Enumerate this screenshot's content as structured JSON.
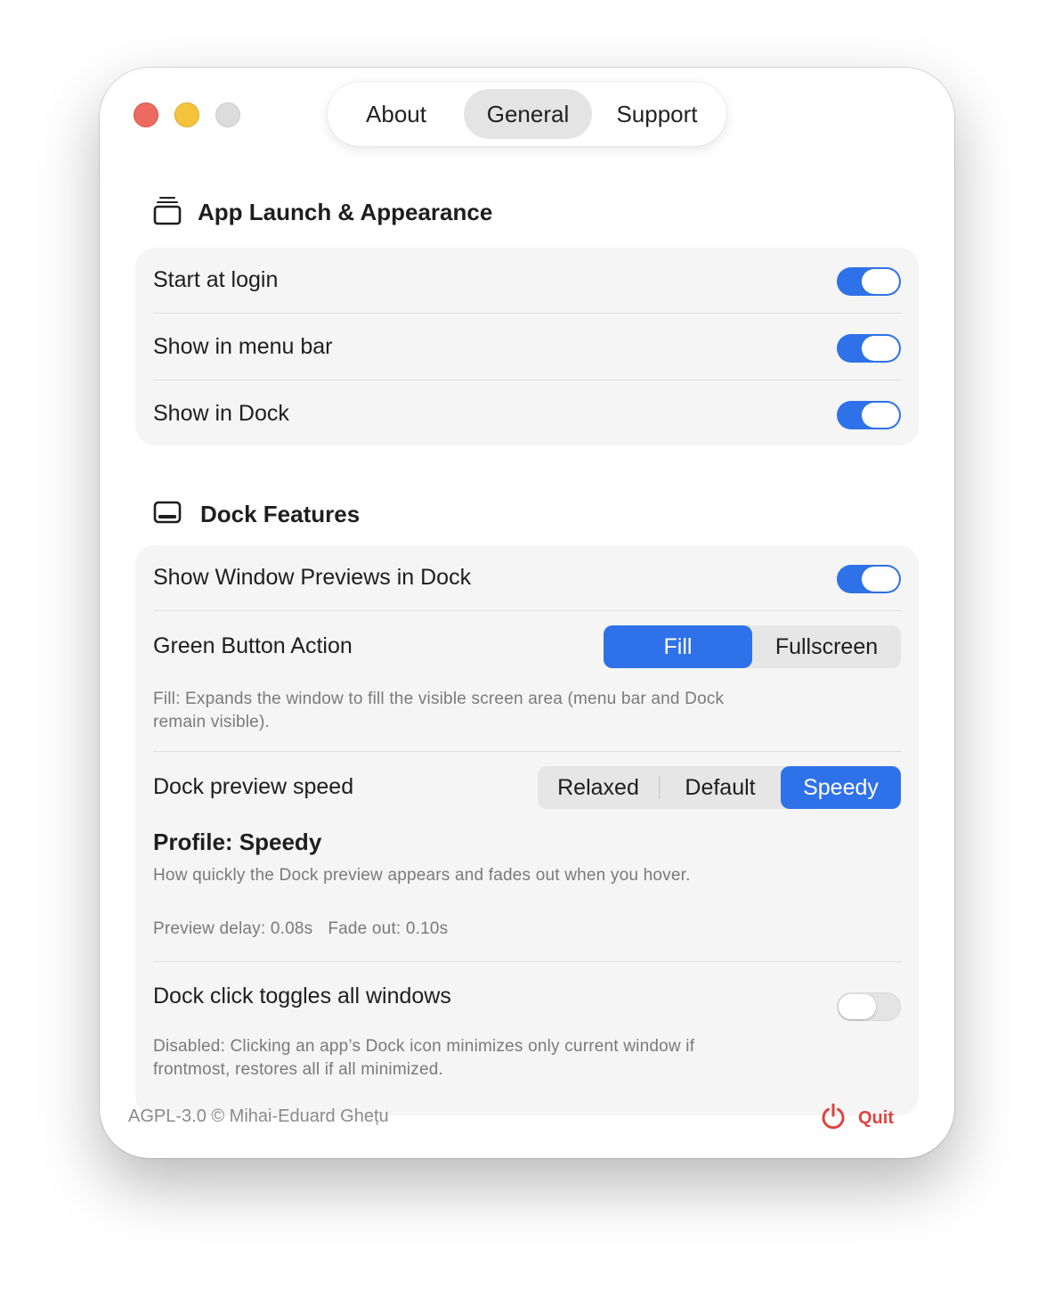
{
  "window": {
    "traffic_lights": {
      "close": "#ed6a5e",
      "minimize": "#f5c33b",
      "zoom": "#dcdcdc"
    }
  },
  "tabs": [
    {
      "label": "About",
      "active": false
    },
    {
      "label": "General",
      "active": true
    },
    {
      "label": "Support",
      "active": false
    }
  ],
  "colors": {
    "accent": "#2f71e8",
    "quit": "#e0433f"
  },
  "app_launch": {
    "icon": "stacked-windows-icon",
    "title": "App Launch & Appearance",
    "rows": [
      {
        "label": "Start at login",
        "enabled": true
      },
      {
        "label": "Show in menu bar",
        "enabled": true
      },
      {
        "label": "Show in Dock",
        "enabled": true
      }
    ]
  },
  "dock_features": {
    "icon": "dock-icon",
    "title": "Dock Features",
    "window_previews": {
      "label": "Show Window Previews in Dock",
      "enabled": true
    },
    "green_button": {
      "label": "Green Button Action",
      "options": [
        "Fill",
        "Fullscreen"
      ],
      "selected": "Fill",
      "help": "Fill: Expands the window to fill the visible screen area (menu bar and Dock remain visible)."
    },
    "preview_speed": {
      "label": "Dock preview speed",
      "options": [
        "Relaxed",
        "Default",
        "Speedy"
      ],
      "selected": "Speedy",
      "profile_title": "Profile: Speedy",
      "profile_desc": "How quickly the Dock preview appears and fades out when you hover.",
      "preview_delay": "Preview delay: 0.08s",
      "fade_out": "Fade out: 0.10s"
    },
    "click_toggles": {
      "label": "Dock click toggles all windows",
      "enabled": false,
      "help": "Disabled: Clicking an app’s Dock icon minimizes only current window if frontmost, restores all if all minimized."
    }
  },
  "footer": {
    "license": "AGPL-3.0 © Mihai-Eduard Ghețu",
    "quit_label": "Quit",
    "quit_icon": "power-icon"
  }
}
